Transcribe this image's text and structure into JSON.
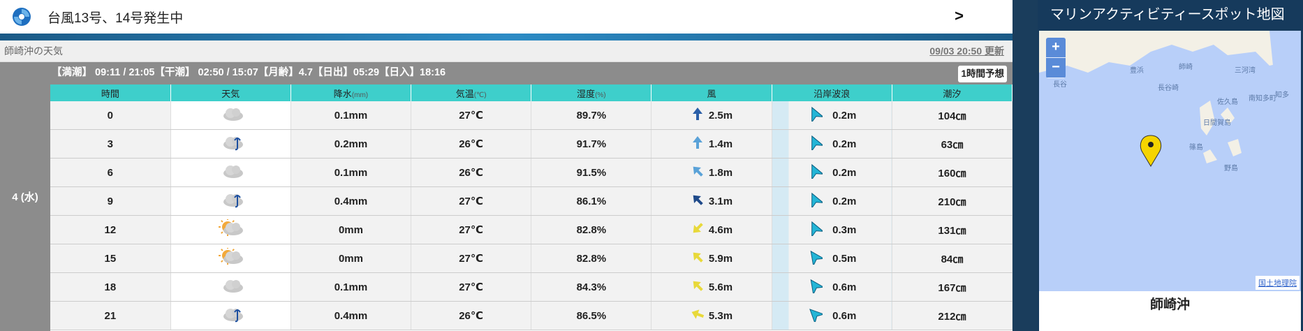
{
  "banner": {
    "text": "台風13号、14号発生中",
    "chevron": ">",
    "icon": "typhoon-icon"
  },
  "place": {
    "name": "師崎沖の天気",
    "updated": "09/03 20:50 更新"
  },
  "tide": {
    "text": "【満潮】 09:11 / 21:05【干潮】 02:50 / 15:07【月齢】4.7【日出】05:29【日入】18:16"
  },
  "forecast_button": "1時間予想",
  "day_label": "4 (水)",
  "headers": {
    "hour": "時間",
    "weather": "天気",
    "precip": "降水",
    "precip_unit": "(mm)",
    "temp": "気温",
    "temp_unit": "(℃)",
    "humidity": "湿度",
    "humidity_unit": "(%)",
    "wind": "風",
    "wave": "沿岸波浪",
    "tide": "潮汐"
  },
  "rows": [
    {
      "hour": "0",
      "weather": "cloudy-icon",
      "precip": "0.1mm",
      "temp": "27℃",
      "humidity": "89.7%",
      "wind": "2.5m",
      "wind_dir": 0,
      "wind_color": "#2b5fa8",
      "wave": "0.2m",
      "wave_dir": -25,
      "tide": "104㎝"
    },
    {
      "hour": "3",
      "weather": "cloudy-rain-icon",
      "precip": "0.2mm",
      "temp": "26℃",
      "humidity": "91.7%",
      "wind": "1.4m",
      "wind_dir": 0,
      "wind_color": "#5aa2d8",
      "wave": "0.2m",
      "wave_dir": -25,
      "tide": "63㎝"
    },
    {
      "hour": "6",
      "weather": "cloudy-icon",
      "precip": "0.1mm",
      "temp": "26℃",
      "humidity": "91.5%",
      "wind": "1.8m",
      "wind_dir": -45,
      "wind_color": "#5aa2d8",
      "wave": "0.2m",
      "wave_dir": -25,
      "tide": "160㎝"
    },
    {
      "hour": "9",
      "weather": "cloudy-rain-icon",
      "precip": "0.4mm",
      "temp": "27℃",
      "humidity": "86.1%",
      "wind": "3.1m",
      "wind_dir": -45,
      "wind_color": "#1f4a8a",
      "wave": "0.2m",
      "wave_dir": -25,
      "tide": "210㎝"
    },
    {
      "hour": "12",
      "weather": "sun-cloud-icon",
      "precip": "0mm",
      "temp": "27℃",
      "humidity": "82.8%",
      "wind": "4.6m",
      "wind_dir": -135,
      "wind_color": "#e8d93a",
      "wave": "0.3m",
      "wave_dir": -25,
      "tide": "131㎝"
    },
    {
      "hour": "15",
      "weather": "sun-cloud-icon",
      "precip": "0mm",
      "temp": "27℃",
      "humidity": "82.8%",
      "wind": "5.9m",
      "wind_dir": -45,
      "wind_color": "#e8d93a",
      "wave": "0.5m",
      "wave_dir": -35,
      "tide": "84㎝"
    },
    {
      "hour": "18",
      "weather": "cloudy-icon",
      "precip": "0.1mm",
      "temp": "27℃",
      "humidity": "84.3%",
      "wind": "5.6m",
      "wind_dir": -45,
      "wind_color": "#e8d93a",
      "wave": "0.6m",
      "wave_dir": -35,
      "tide": "167㎝"
    },
    {
      "hour": "21",
      "weather": "cloudy-rain-icon",
      "precip": "0.4mm",
      "temp": "26℃",
      "humidity": "86.5%",
      "wind": "5.3m",
      "wind_dir": -70,
      "wind_color": "#e8d93a",
      "wave": "0.6m",
      "wave_dir": -45,
      "tide": "212㎝"
    }
  ],
  "map": {
    "title": "マリンアクティビティースポット地図",
    "zoom_in": "+",
    "zoom_out": "−",
    "attribution": "国土地理院",
    "spot": "師崎沖",
    "labels": [
      "長谷",
      "長谷崎",
      "三河湾",
      "日間賀島",
      "佐久島",
      "南知多町",
      "知多",
      "篠島",
      "野島",
      "豊浜",
      "師崎"
    ]
  },
  "colors": {
    "teal": "#3ecfcb",
    "gray": "#8c8c8c",
    "pin": "#f5d400",
    "map_sea": "#b8cff9"
  }
}
